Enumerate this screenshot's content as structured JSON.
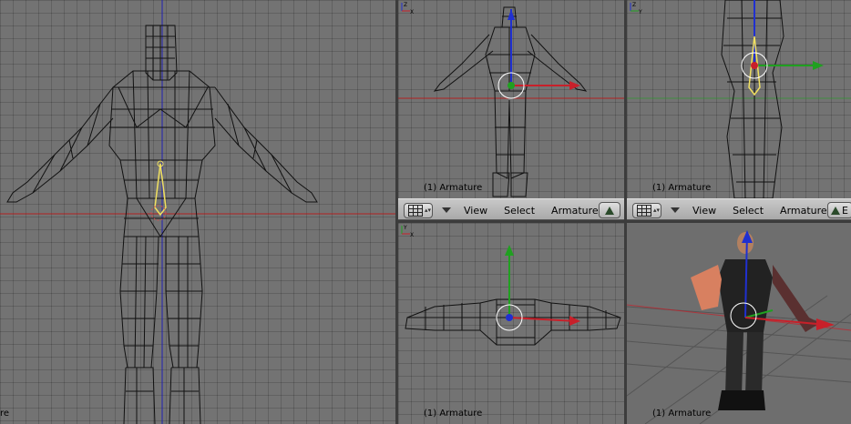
{
  "viewports": {
    "front_large": {
      "label": "re"
    },
    "top_left_small": {
      "label": "(1) Armature",
      "axes": [
        "Z",
        "X"
      ]
    },
    "top_right_small": {
      "label": "(1) Armature",
      "axes": [
        "Z",
        "Y"
      ]
    },
    "bottom_left_small": {
      "label": "(1) Armature",
      "axes": [
        "Y",
        "X"
      ]
    },
    "bottom_right_small": {
      "label": "(1) Armature"
    }
  },
  "header_left": {
    "menus": [
      "View",
      "Select",
      "Armature"
    ]
  },
  "header_right": {
    "menus": [
      "View",
      "Select",
      "Armature"
    ],
    "cut_label": "E"
  },
  "colors": {
    "grid_bg": "#737373",
    "x_axis": "#c8202a",
    "y_axis": "#20a020",
    "z_axis": "#2030d0",
    "bone": "#f0e060"
  },
  "icons": [
    "viewport-type-icon",
    "dropdown-arrow-icon",
    "edit-mode-icon",
    "axis-gizmo-icon",
    "manipulator-icon"
  ]
}
